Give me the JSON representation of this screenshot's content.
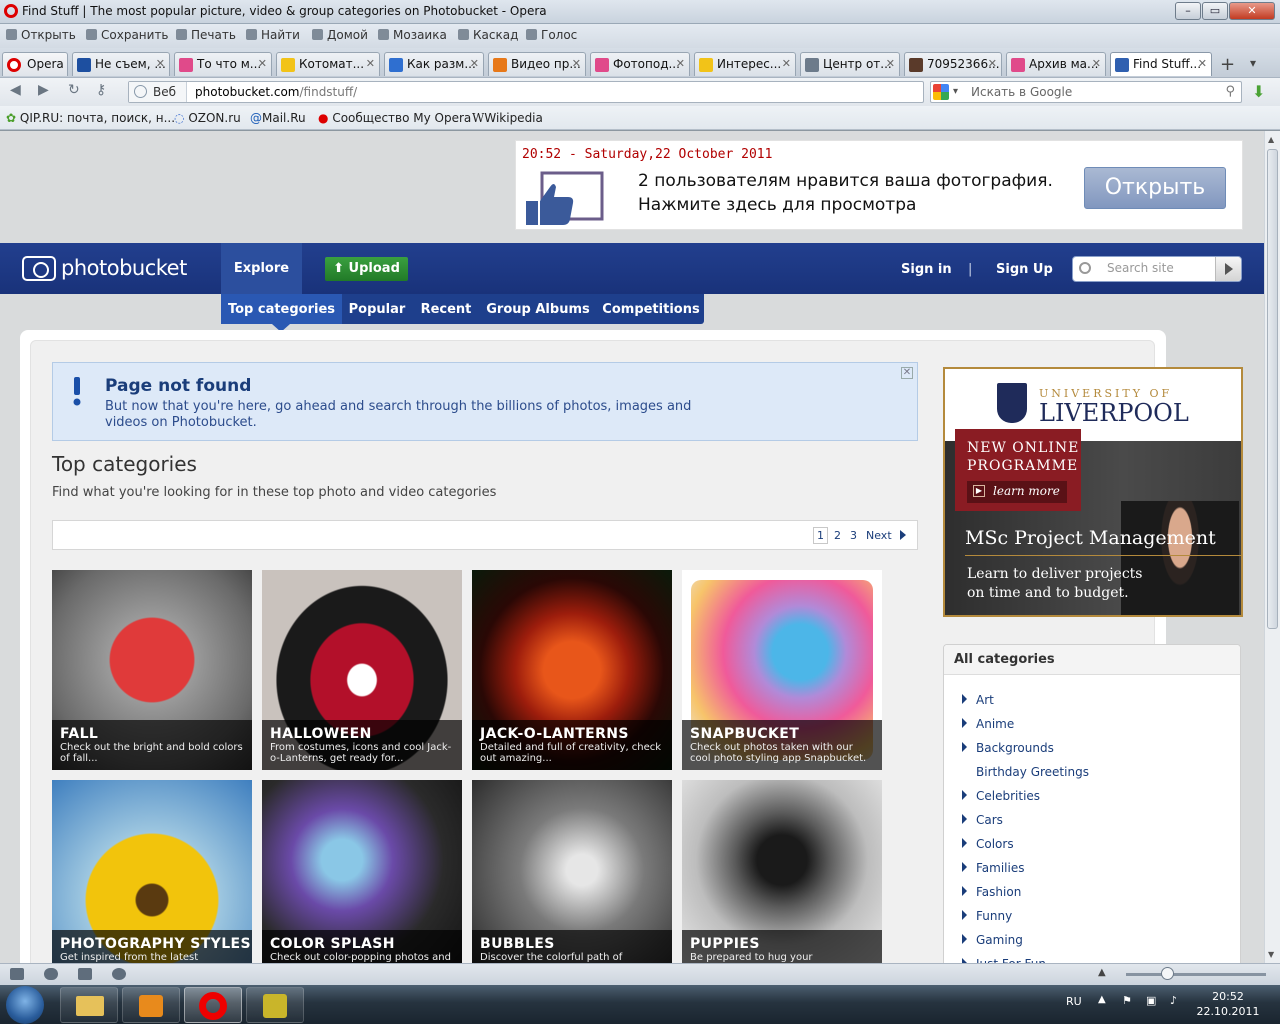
{
  "window": {
    "title": "Find Stuff | The most popular picture, video & group categories on Photobucket - Opera"
  },
  "menu": [
    {
      "label": "Opera"
    },
    {
      "label": "Открыть"
    },
    {
      "label": "Сохранить"
    },
    {
      "label": "Печать"
    },
    {
      "label": "Найти"
    },
    {
      "label": "Домой"
    },
    {
      "label": "Мозаика"
    },
    {
      "label": "Каскад"
    },
    {
      "label": "Голос"
    }
  ],
  "tabs": [
    {
      "label": "Не съем, ...",
      "color": "#1d4fa0"
    },
    {
      "label": "То что м...",
      "color": "#e04a8a"
    },
    {
      "label": "Котомат...",
      "color": "#f2c318"
    },
    {
      "label": "Как разм...",
      "color": "#2f6fd0"
    },
    {
      "label": "Видео пр...",
      "color": "#e77819"
    },
    {
      "label": "Фотопод...",
      "color": "#e04a8a"
    },
    {
      "label": "Интерес...",
      "color": "#f2c318"
    },
    {
      "label": "Центр от...",
      "color": "#6d7b8b"
    },
    {
      "label": "70952366...",
      "color": "#5a3a2a"
    },
    {
      "label": "Архив ма...",
      "color": "#e04a8a"
    },
    {
      "label": "Find Stuff...",
      "color": "#3060b0"
    }
  ],
  "address": {
    "veb_label": "Веб",
    "url_host": "photobucket.com",
    "url_path": "/findstuff/",
    "search_placeholder": "Искать в Google"
  },
  "bookmarks": [
    {
      "label": "QIP.RU: почта, поиск, н..."
    },
    {
      "label": "OZON.ru"
    },
    {
      "label": "Mail.Ru"
    },
    {
      "label": "Сообщество My Opera"
    },
    {
      "label": "Wikipedia"
    }
  ],
  "ad": {
    "timestamp": "20:52 - Saturday,22 October 2011",
    "line1": "2 пользователям нравится ваша фотография.",
    "line2": "Нажмите здесь для просмотра",
    "button": "Открыть"
  },
  "pb": {
    "logo": "photobucket",
    "explore": "Explore",
    "upload": "Upload",
    "signin": "Sign in",
    "sep": "|",
    "signup": "Sign Up",
    "search_placeholder": "Search site",
    "subnav": [
      "Top categories",
      "Popular",
      "Recent",
      "Group Albums",
      "Competitions"
    ]
  },
  "notice": {
    "title": "Page not found",
    "body": "But now that you're here, go ahead and search through the billions of photos, images and videos on Photobucket."
  },
  "top": {
    "heading": "Top categories",
    "subheading": "Find what you're looking for in these top photo and video categories",
    "pages": [
      "1",
      "2",
      "3"
    ],
    "next": "Next"
  },
  "tiles": [
    {
      "title": "FALL",
      "desc": "Check out the bright and bold colors of fall..."
    },
    {
      "title": "HALLOWEEN",
      "desc": "From costumes, icons and cool Jack-o-Lanterns, get ready for..."
    },
    {
      "title": "JACK-O-LANTERNS",
      "desc": "Detailed and full of creativity, check out amazing..."
    },
    {
      "title": "SNAPBUCKET",
      "desc": "Check out photos taken with our cool photo styling app Snapbucket."
    },
    {
      "title": "PHOTOGRAPHY STYLES",
      "desc": "Get inspired from the latest"
    },
    {
      "title": "COLOR SPLASH",
      "desc": "Check out color-popping photos and"
    },
    {
      "title": "BUBBLES",
      "desc": "Discover the colorful path of bubbles"
    },
    {
      "title": "PUPPIES",
      "desc": "Be prepared to hug your"
    }
  ],
  "liverpool": {
    "univ": "UNIVERSITY OF",
    "name": "LIVERPOOL",
    "nop1": "NEW ONLINE",
    "nop2": "PROGRAMME",
    "learn": "learn more",
    "msc": "MSc Project Management",
    "deliver1": "Learn to deliver projects",
    "deliver2": "on time and to budget."
  },
  "categories": {
    "heading": "All categories",
    "items": [
      {
        "label": "Art",
        "arrow": true
      },
      {
        "label": "Anime",
        "arrow": true
      },
      {
        "label": "Backgrounds",
        "arrow": true
      },
      {
        "label": "Birthday Greetings",
        "arrow": false
      },
      {
        "label": "Celebrities",
        "arrow": true
      },
      {
        "label": "Cars",
        "arrow": true
      },
      {
        "label": "Colors",
        "arrow": true
      },
      {
        "label": "Families",
        "arrow": true
      },
      {
        "label": "Fashion",
        "arrow": true
      },
      {
        "label": "Funny",
        "arrow": true
      },
      {
        "label": "Gaming",
        "arrow": true
      },
      {
        "label": "Just For Fun",
        "arrow": true
      }
    ]
  },
  "taskbar": {
    "lang": "RU",
    "time": "20:52",
    "date": "22.10.2011"
  }
}
